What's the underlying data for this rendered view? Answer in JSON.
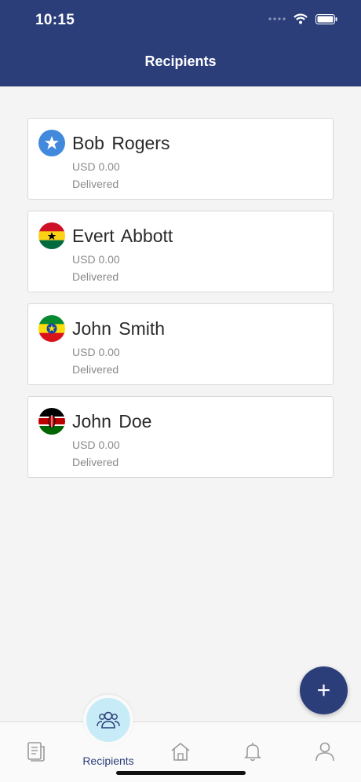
{
  "status_bar": {
    "time": "10:15"
  },
  "header": {
    "title": "Recipients"
  },
  "recipients": [
    {
      "name": "Bob Rogers",
      "amount": "USD 0.00",
      "status": "Delivered",
      "flag_icon": "somalia-flag-icon"
    },
    {
      "name": "Evert Abbott",
      "amount": "USD 0.00",
      "status": "Delivered",
      "flag_icon": "ghana-flag-icon"
    },
    {
      "name": "John Smith",
      "amount": "USD 0.00",
      "status": "Delivered",
      "flag_icon": "ethiopia-flag-icon"
    },
    {
      "name": "John Doe",
      "amount": "USD 0.00",
      "status": "Delivered",
      "flag_icon": "kenya-flag-icon"
    }
  ],
  "fab": {
    "icon": "plus-icon",
    "label": "+"
  },
  "tabbar": {
    "items": [
      {
        "icon": "transactions-icon"
      },
      {
        "icon": "recipients-icon",
        "label": "Recipients",
        "active": true
      },
      {
        "icon": "home-icon"
      },
      {
        "icon": "bell-icon"
      },
      {
        "icon": "profile-icon"
      }
    ]
  },
  "colors": {
    "primary": "#2b3e7a",
    "active_tab_bg": "#c7ecf7",
    "background": "#f4f4f4"
  }
}
